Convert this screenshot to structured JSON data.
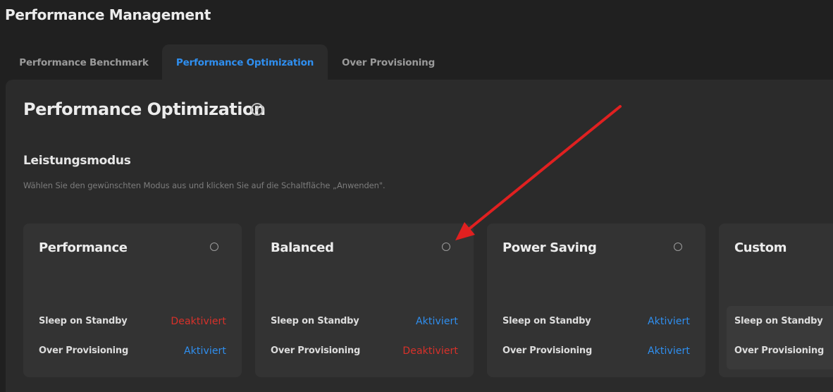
{
  "app_title": "Performance Management",
  "tabs": [
    {
      "label": "Performance Benchmark",
      "active": false
    },
    {
      "label": "Performance Optimization",
      "active": true
    },
    {
      "label": "Over Provisioning",
      "active": false
    }
  ],
  "section": {
    "title": "Performance Optimization",
    "help_symbol": "?",
    "heading": "Leistungsmodus",
    "description": "Wählen Sie den gewünschten Modus aus und klicken Sie auf die Schaltfläche „Anwenden\"."
  },
  "cards": [
    {
      "title": "Performance",
      "selected": false,
      "rows": [
        {
          "label": "Sleep on Standby",
          "value": "Deaktiviert",
          "status": "off"
        },
        {
          "label": "Over Provisioning",
          "value": "Aktiviert",
          "status": "on"
        }
      ]
    },
    {
      "title": "Balanced",
      "selected": false,
      "rows": [
        {
          "label": "Sleep on Standby",
          "value": "Aktiviert",
          "status": "on"
        },
        {
          "label": "Over Provisioning",
          "value": "Deaktiviert",
          "status": "off"
        }
      ]
    },
    {
      "title": "Power Saving",
      "selected": false,
      "rows": [
        {
          "label": "Sleep on Standby",
          "value": "Aktiviert",
          "status": "on"
        },
        {
          "label": "Over Provisioning",
          "value": "Aktiviert",
          "status": "on"
        }
      ]
    },
    {
      "title": "Custom",
      "selected": false,
      "rows": [
        {
          "label": "Sleep on Standby",
          "value": "",
          "status": ""
        },
        {
          "label": "Over Provisioning",
          "value": "",
          "status": ""
        }
      ]
    }
  ],
  "colors": {
    "accent": "#2f8ff0",
    "deactivated": "#d9312a",
    "annotation_arrow": "#e02020"
  }
}
